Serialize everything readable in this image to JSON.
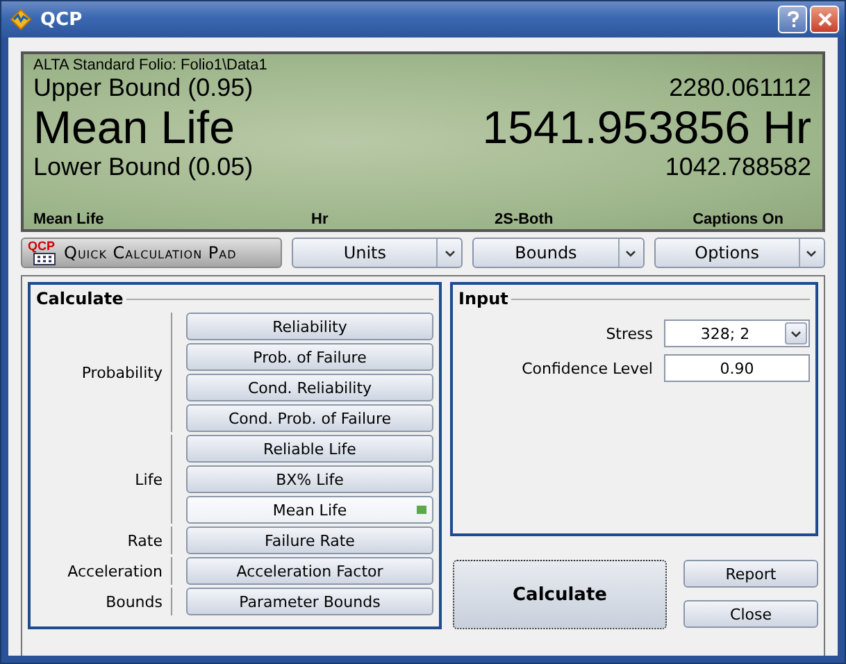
{
  "window": {
    "title": "QCP"
  },
  "display": {
    "source": "ALTA Standard Folio: Folio1\\Data1",
    "upper_label": "Upper Bound (0.95)",
    "upper_value": "2280.061112",
    "main_label": "Mean Life",
    "main_value": "1541.953856 Hr",
    "lower_label": "Lower Bound (0.05)",
    "lower_value": "1042.788582",
    "status": [
      "Mean Life",
      "Hr",
      "2S-Both",
      "Captions On"
    ]
  },
  "toolbar": {
    "logo": "QCP",
    "pad_label": "Quick Calculation Pad",
    "menus": [
      "Units",
      "Bounds",
      "Options"
    ]
  },
  "calculate": {
    "title": "Calculate",
    "groups": [
      {
        "label": "Probability",
        "buttons": [
          {
            "label": "Reliability",
            "selected": false
          },
          {
            "label": "Prob. of Failure",
            "selected": false
          },
          {
            "label": "Cond. Reliability",
            "selected": false
          },
          {
            "label": "Cond. Prob. of Failure",
            "selected": false
          }
        ]
      },
      {
        "label": "Life",
        "buttons": [
          {
            "label": "Reliable Life",
            "selected": false
          },
          {
            "label": "BX% Life",
            "selected": false
          },
          {
            "label": "Mean Life",
            "selected": true
          }
        ]
      },
      {
        "label": "Rate",
        "buttons": [
          {
            "label": "Failure Rate",
            "selected": false
          }
        ]
      },
      {
        "label": "Acceleration",
        "buttons": [
          {
            "label": "Acceleration Factor",
            "selected": false
          }
        ]
      },
      {
        "label": "Bounds",
        "buttons": [
          {
            "label": "Parameter Bounds",
            "selected": false
          }
        ]
      }
    ]
  },
  "input": {
    "title": "Input",
    "fields": [
      {
        "kind": "dropdown",
        "label": "Stress",
        "value": "328; 2"
      },
      {
        "kind": "text",
        "label": "Confidence Level",
        "value": "0.90"
      }
    ]
  },
  "actions": {
    "main": "Calculate",
    "side": [
      "Report",
      "Close"
    ]
  }
}
